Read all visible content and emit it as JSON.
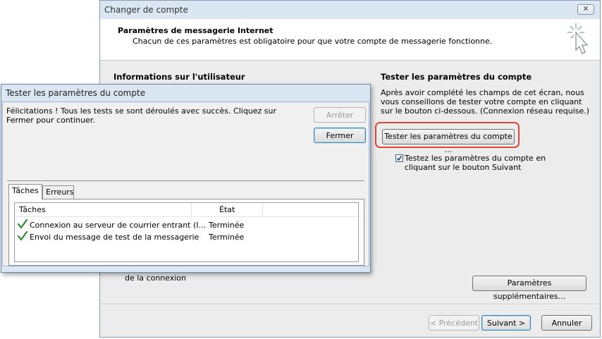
{
  "main_dialog": {
    "title": "Changer de compte",
    "close_glyph": "✕",
    "header": {
      "title": "Paramètres de messagerie Internet",
      "subtitle": "Chacun de ces paramètres est obligatoire pour que votre compte de messagerie fonctionne."
    },
    "user_info_title": "Informations sur l'utilisateur",
    "test_section": {
      "title": "Tester les paramètres du compte",
      "description": "Après avoir complété les champs de cet écran, nous vous conseillons de tester votre compte en cliquant sur le bouton ci-dessous. (Connexion réseau requise.)",
      "test_button": "Tester les paramètres du compte ...",
      "checkbox_checked": true,
      "checkbox_label": "Testez les paramètres du compte en cliquant sur le bouton Suivant"
    },
    "partial_label": "de la connexion",
    "more_settings_button": "Paramètres supplémentaires...",
    "footer": {
      "prev_button": "< Précédent",
      "next_button": "Suivant >",
      "cancel_button": "Annuler"
    }
  },
  "test_dialog": {
    "title": "Tester les paramètres du compte",
    "message": "Félicitations ! Tous les tests se sont déroulés avec succès. Cliquez sur Fermer pour continuer.",
    "stop_button": "Arrêter",
    "close_button": "Fermer",
    "tabs": [
      "Tâches",
      "Erreurs"
    ],
    "columns": [
      "Tâches",
      "État"
    ],
    "rows": [
      {
        "task": "Connexion au serveur de courrier entrant (I...",
        "state": "Terminée",
        "icon": "checkmark-icon"
      },
      {
        "task": "Envoi du message de test de la messagerie",
        "state": "Terminée",
        "icon": "checkmark-icon"
      }
    ]
  },
  "colors": {
    "highlight": "#e0463a",
    "success": "#2e8b2e",
    "titlebar": "#dbe6f3"
  }
}
